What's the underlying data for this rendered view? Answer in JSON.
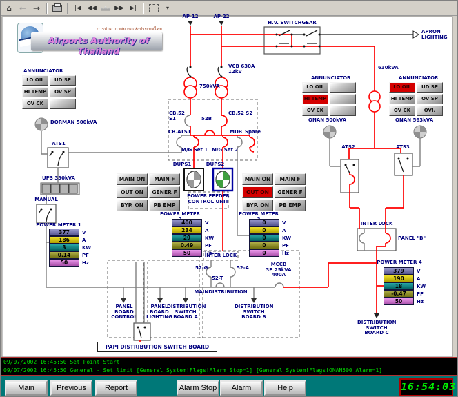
{
  "toolbar": {
    "icons": [
      "home-icon",
      "back-icon",
      "forward-icon",
      "print-icon",
      "first-page-icon",
      "prev-page-icon",
      "pages-icon",
      "next-page-icon",
      "last-page-icon",
      "select-mode-icon",
      "dropdown-arrow-icon"
    ]
  },
  "logo": {
    "thai": "การท่าอากาศยานแห่งประเทศไทย",
    "english": "Airports Authority of Thailand"
  },
  "labels": {
    "ap12": "AP-12",
    "ap22": "AP-22",
    "hv_switchgear": "H.V. SWITCHGEAR",
    "apron_lighting": "APRON\nLIGHTING",
    "vcb": "VCB 630A\n12kV",
    "kva750": "750kVA",
    "kva630": "630kVA",
    "cb52s1": "CB.52 S1",
    "b52": "52B",
    "cb52s2": "CB.52 S2",
    "cbats1": "CB.ATS1",
    "mdb": "MDB",
    "spare": "Spare",
    "mg1": "M/G Set 1",
    "mg2": "M/G Set 2",
    "dups1": "DUPS1",
    "dups2": "DUPS2",
    "pfcu": "POWER FEEDER\nCONTROL UNIT",
    "dorman": "DORMAN 500kVA",
    "ats1": "ATS1",
    "ats2": "ATS2",
    "ats3": "ATS3",
    "ups": "UPS 330kVA",
    "manual": "MANUAL",
    "onan500": "ONAN 500kVA",
    "onan563": "ONAN 563kVA",
    "interlock_center": "INTER LOCK",
    "interlock_right": "INTER LOCK",
    "panel_b": "PANEL \"B\"",
    "g52": "52-G",
    "a52": "52-A",
    "t52": "52-T",
    "maindistribution": "MAINDISTRIBUTION",
    "mccb": "MCCB\n3P 25kVA\n400A",
    "pbc": "PANEL\nBOARD\nCONTROL",
    "pbl": "PANEL\nBOARD\nLIGHTING",
    "dsba": "DISTRIBUTION\nSWITCH\nBOARD A",
    "dsbb": "DISTRIBUTION\nSWITCH\nBOARD B",
    "dsbc": "DISTRIBUTION\nSWITCH\nBOARD C",
    "papi": "PAPI DISTRIBUTION SWITCH BOARD"
  },
  "ann": {
    "left": {
      "title": "ANNUNCIATOR",
      "cells": [
        {
          "t": "LO OIL",
          "alarm": false
        },
        {
          "t": "UD SP",
          "alarm": false
        },
        {
          "t": "HI TEMP",
          "alarm": false
        },
        {
          "t": "OV SP",
          "alarm": false
        },
        {
          "t": "OV CK",
          "alarm": false
        },
        {
          "t": "",
          "alarm": false
        }
      ]
    },
    "middle": {
      "title": "ANNUNCIATOR",
      "cells": [
        {
          "t": "LO OIL",
          "alarm": false
        },
        {
          "t": "",
          "alarm": false
        },
        {
          "t": "HI TEMP",
          "alarm": true
        },
        {
          "t": "",
          "alarm": false
        },
        {
          "t": "OV CK",
          "alarm": false
        },
        {
          "t": "",
          "alarm": false
        }
      ]
    },
    "right": {
      "title": "ANNUNCIATOR",
      "cells": [
        {
          "t": "LO OIL",
          "alarm": true
        },
        {
          "t": "UD SP",
          "alarm": false
        },
        {
          "t": "HI TEMP",
          "alarm": false
        },
        {
          "t": "OV SP",
          "alarm": false
        },
        {
          "t": "OV CK",
          "alarm": false
        },
        {
          "t": "OVI.",
          "alarm": false
        }
      ]
    }
  },
  "panels": {
    "left": {
      "cells": [
        {
          "t": "MAIN ON",
          "alarm": false
        },
        {
          "t": "MAIN F",
          "alarm": false
        },
        {
          "t": "OUT ON",
          "alarm": false
        },
        {
          "t": "GENER F",
          "alarm": false
        },
        {
          "t": "BYP. ON",
          "alarm": false
        },
        {
          "t": "PB EMP",
          "alarm": false
        }
      ]
    },
    "right": {
      "cells": [
        {
          "t": "MAIN ON",
          "alarm": false
        },
        {
          "t": "MAIN F",
          "alarm": false
        },
        {
          "t": "OUT ON",
          "alarm": true
        },
        {
          "t": "GENER F",
          "alarm": false
        },
        {
          "t": "BYP. ON",
          "alarm": false
        },
        {
          "t": "PB EMP",
          "alarm": false
        }
      ]
    }
  },
  "meters": {
    "pm1": {
      "title": "POWER METER 1",
      "rows": [
        {
          "value": "377",
          "unit": "V"
        },
        {
          "value": "186",
          "unit": "A"
        },
        {
          "value": "3",
          "unit": "KW"
        },
        {
          "value": "0.14",
          "unit": "PF"
        },
        {
          "value": "50",
          "unit": "Hz"
        }
      ]
    },
    "pm2": {
      "title": "POWER METER 2",
      "rows": [
        {
          "value": "400",
          "unit": "V"
        },
        {
          "value": "234",
          "unit": "A"
        },
        {
          "value": "29",
          "unit": "KW"
        },
        {
          "value": "0.49",
          "unit": "PF"
        },
        {
          "value": "50",
          "unit": "Hz"
        }
      ]
    },
    "pm3": {
      "title": "POWER METER 3",
      "rows": [
        {
          "value": "0",
          "unit": "V"
        },
        {
          "value": "0",
          "unit": "A"
        },
        {
          "value": "0",
          "unit": "KW"
        },
        {
          "value": "0",
          "unit": "PF"
        },
        {
          "value": "0",
          "unit": "Hz"
        }
      ]
    },
    "pm4": {
      "title": "POWER METER 4",
      "rows": [
        {
          "value": "379",
          "unit": "V"
        },
        {
          "value": "190",
          "unit": "A"
        },
        {
          "value": "18",
          "unit": "KW"
        },
        {
          "value": "-0.47",
          "unit": "PF"
        },
        {
          "value": "50",
          "unit": "Hz"
        }
      ]
    }
  },
  "status_log": {
    "lines": [
      "09/07/2002 16:45:50 Set Point Start",
      "09/07/2002 16:45:50 General - Set limit [General System!Flags!Alarm Stop=1] [General System!Flags!ONAN500 Alarm=1]"
    ]
  },
  "footer": {
    "buttons": [
      "Main",
      "Previous",
      "Report",
      "Alarm Stop",
      "Alarm Reset",
      "Help"
    ],
    "clock": "16:54:03"
  },
  "colors": {
    "energized_line": "#ff0000",
    "deenergized_line": "#808080",
    "alarm": "#d40000",
    "meter_v": "#7070b0",
    "meter_a": "#d8c800",
    "meter_kw": "#008080",
    "meter_pf": "#90901c",
    "meter_hz": "#cc70cc",
    "footer_teal": "#007878",
    "status_green": "#00dd00"
  }
}
